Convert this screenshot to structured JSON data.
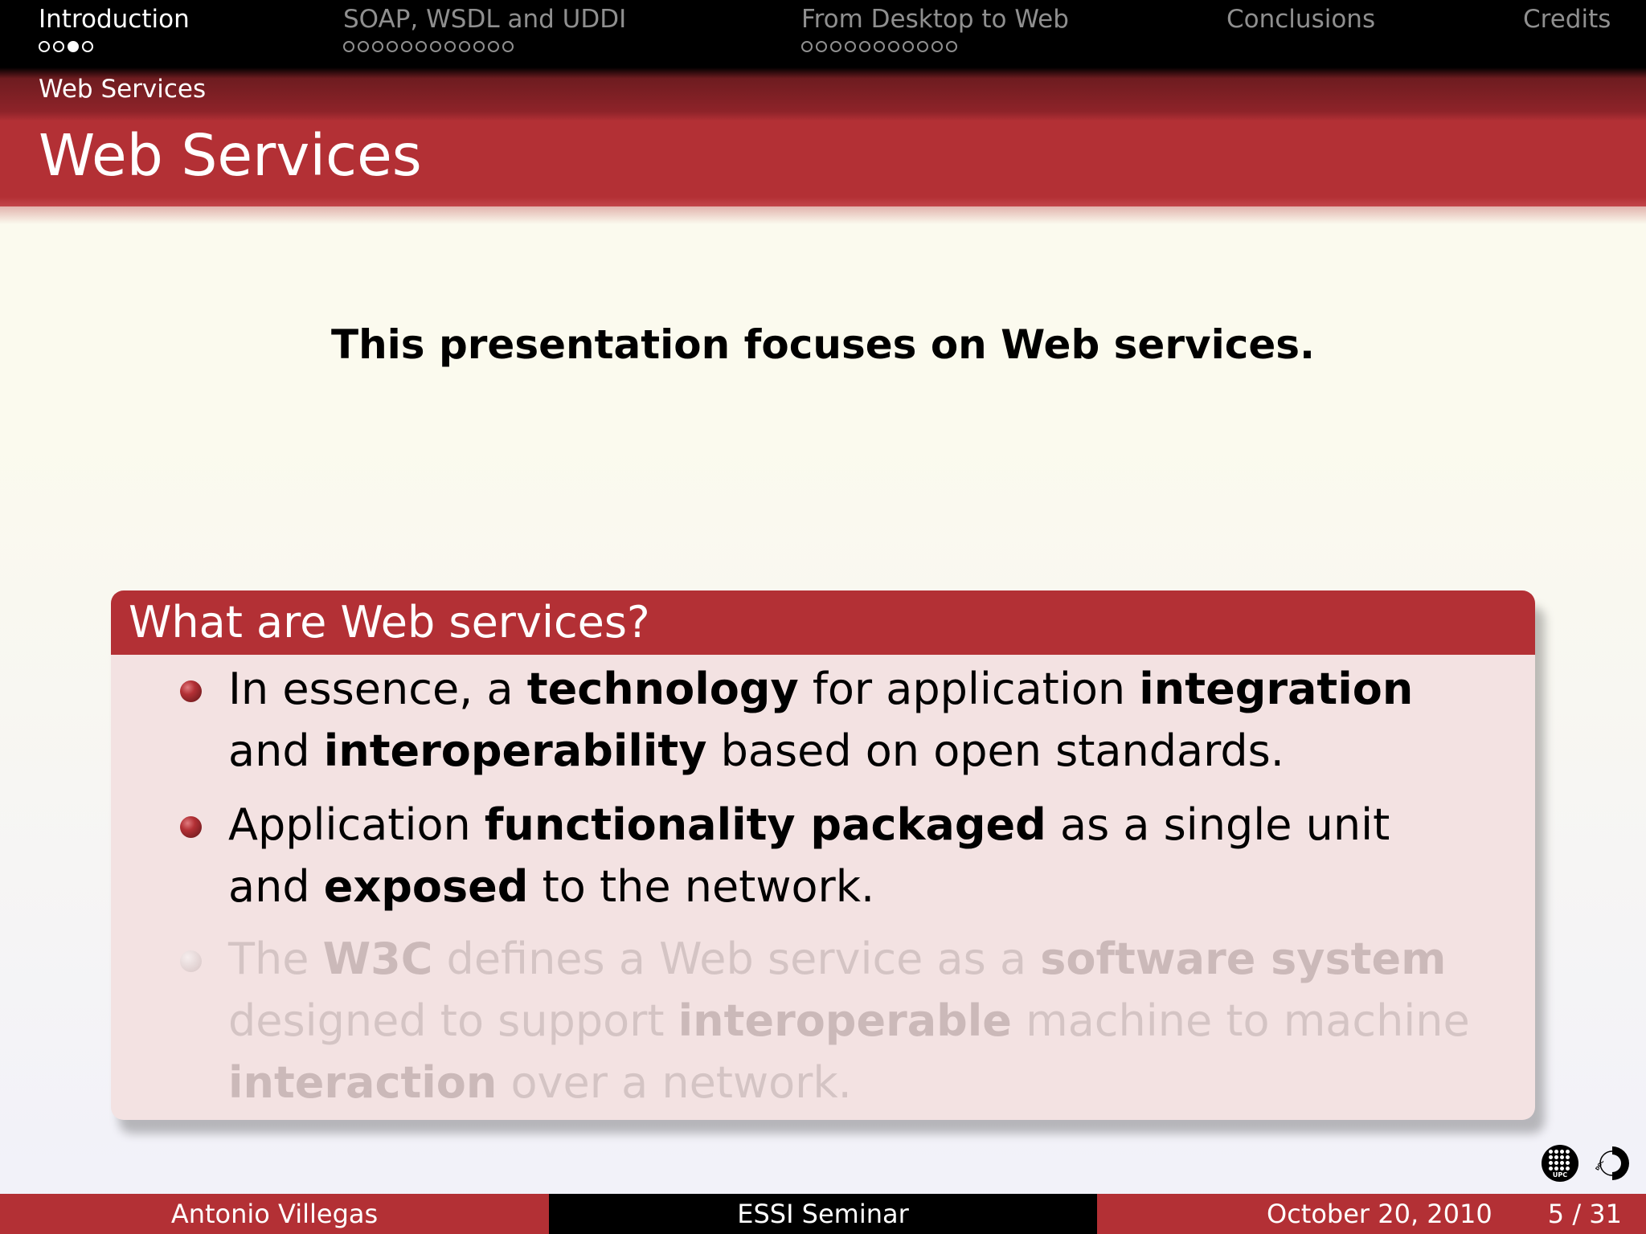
{
  "nav": {
    "sections": [
      {
        "label": "Introduction",
        "dots": 4,
        "current": 2
      },
      {
        "label": "SOAP, WSDL and UDDI",
        "dots": 12,
        "current": -1
      },
      {
        "label": "From Desktop to Web",
        "dots": 11,
        "current": -1
      },
      {
        "label": "Conclusions",
        "dots": 0,
        "current": -1
      },
      {
        "label": "Credits",
        "dots": 0,
        "current": -1
      }
    ]
  },
  "subsection": "Web Services",
  "frame_title": "Web Services",
  "lead": "This presentation focuses on Web services.",
  "block": {
    "title": "What are Web services?",
    "items": [
      {
        "parts": [
          {
            "t": "In essence, a "
          },
          {
            "t": "technology",
            "b": true
          },
          {
            "t": " for application "
          },
          {
            "t": "integration",
            "b": true
          },
          {
            "t": " and "
          },
          {
            "t": "interoperability",
            "b": true
          },
          {
            "t": " based on open standards."
          }
        ]
      },
      {
        "parts": [
          {
            "t": "Application "
          },
          {
            "t": "functionality packaged",
            "b": true
          },
          {
            "t": " as a single unit and "
          },
          {
            "t": "exposed",
            "b": true
          },
          {
            "t": " to the network."
          }
        ]
      },
      {
        "parts": [
          {
            "t": "The "
          },
          {
            "t": "W3C",
            "b": true
          },
          {
            "t": " defines a Web service as a "
          },
          {
            "t": "software system",
            "b": true
          },
          {
            "t": " designed to support "
          },
          {
            "t": "interoperable",
            "b": true
          },
          {
            "t": " machine to machine "
          },
          {
            "t": "interaction",
            "b": true
          },
          {
            "t": " over a network."
          }
        ],
        "faded": true
      }
    ]
  },
  "logos": {
    "upc_text": "UPC",
    "doc_text": "DOCTORATE"
  },
  "footer": {
    "author": "Antonio Villegas",
    "event": "ESSI Seminar",
    "date": "October 20, 2010",
    "page": "5 / 31"
  },
  "colors": {
    "accent": "#b33035",
    "block_bg": "#f3e2e2",
    "nav_bg": "#000000"
  }
}
